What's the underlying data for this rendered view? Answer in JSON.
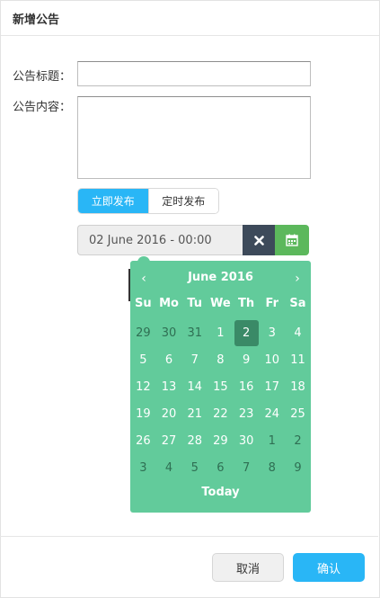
{
  "dialog": {
    "title": "新增公告"
  },
  "form": {
    "title_label": "公告标题：",
    "title_value": "",
    "content_label": "公告内容：",
    "content_value": ""
  },
  "publish_mode": {
    "options": [
      "立即发布",
      "定时发布"
    ],
    "selected": "立即发布"
  },
  "datetime": {
    "value": "02 June 2016 - 00:00",
    "clear_icon": "times-icon",
    "calendar_icon": "calendar-icon"
  },
  "calendar": {
    "prev": "‹",
    "next": "›",
    "month_label": "June 2016",
    "weekdays": [
      "Su",
      "Mo",
      "Tu",
      "We",
      "Th",
      "Fr",
      "Sa"
    ],
    "weeks": [
      [
        "29",
        "30",
        "31",
        "1",
        "2",
        "3",
        "4"
      ],
      [
        "5",
        "6",
        "7",
        "8",
        "9",
        "10",
        "11"
      ],
      [
        "12",
        "13",
        "14",
        "15",
        "16",
        "17",
        "18"
      ],
      [
        "19",
        "20",
        "21",
        "22",
        "23",
        "24",
        "25"
      ],
      [
        "26",
        "27",
        "28",
        "29",
        "30",
        "1",
        "2"
      ],
      [
        "3",
        "4",
        "5",
        "6",
        "7",
        "8",
        "9"
      ]
    ],
    "selected_day": "2",
    "today_label": "Today",
    "colors": {
      "background": "#62cb9b",
      "selected": "#3a8a67",
      "muted_text": "#2f6f53"
    }
  },
  "footer": {
    "cancel_label": "取消",
    "confirm_label": "确认"
  },
  "colors": {
    "primary": "#29b6f6",
    "clear_button": "#3d4a5a",
    "calendar_button": "#5cb85c"
  }
}
